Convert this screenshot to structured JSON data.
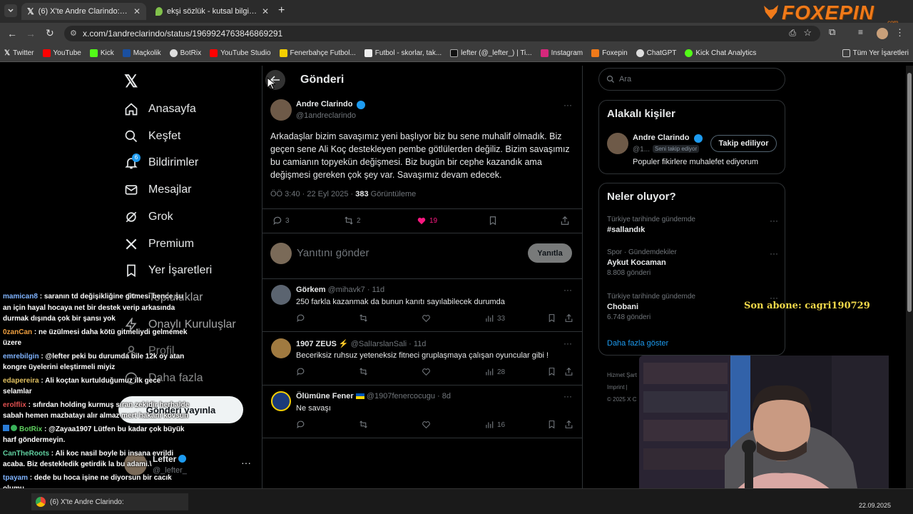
{
  "browser": {
    "tabs": [
      {
        "title": "(6) X'te Andre Clarindo: \"Arkad...",
        "active": true
      },
      {
        "title": "ekşi sözlük - kutsal bilgi kaynağı",
        "active": false
      }
    ],
    "url": "x.com/1andreclarindo/status/1969924763846869291",
    "bookmarks": [
      "Twitter",
      "YouTube",
      "Kick",
      "Maçkolik",
      "BotRix",
      "YouTube Studio",
      "Fenerbahçe Futbol...",
      "Futbol - skorlar, tak...",
      "lefter (@_lefter_) | Ti...",
      "Instagram",
      "Foxepin",
      "ChatGPT",
      "Kick Chat Analytics"
    ],
    "all_bookmarks": "Tüm Yer İşaretleri"
  },
  "brand": {
    "logo_text": "FOXEPIN",
    "logo_sub": ".com"
  },
  "nav": {
    "items": [
      {
        "label": "Anasayfa",
        "icon": "home-icon"
      },
      {
        "label": "Keşfet",
        "icon": "search-icon"
      },
      {
        "label": "Bildirimler",
        "icon": "bell-icon",
        "badge": "6"
      },
      {
        "label": "Mesajlar",
        "icon": "mail-icon"
      },
      {
        "label": "Grok",
        "icon": "grok-icon"
      },
      {
        "label": "Premium",
        "icon": "x-icon"
      },
      {
        "label": "Yer İşaretleri",
        "icon": "bookmark-icon"
      },
      {
        "label": "Topluluklar",
        "icon": "people-icon"
      },
      {
        "label": "Onaylı Kuruluşlar",
        "icon": "lightning-icon"
      },
      {
        "label": "Profil",
        "icon": "person-icon"
      },
      {
        "label": "Daha fazla",
        "icon": "more-icon"
      }
    ],
    "post_button": "Gönderi yayınla",
    "account_name": "Lefter",
    "account_handle": "@_lefter_"
  },
  "header": {
    "title": "Gönderi"
  },
  "tweet": {
    "author": "Andre Clarindo",
    "handle": "@1andreclarindo",
    "text": "Arkadaşlar bizim savaşımız yeni başlıyor biz bu sene muhalif olmadık. Biz geçen sene Ali Koç destekleyen pembe götlülerden değiliz. Bizim savaşımız bu camianın topyekün değişmesi. Biz bugün bir cephe kazandık ama değişmesi gereken çok şey var. Savaşımız devam edecek.",
    "time": "ÖÖ 3:40 · 22 Eyl 2025 ·",
    "views": "383",
    "views_label": "Görüntüleme",
    "replies": "3",
    "reposts": "2",
    "likes": "19"
  },
  "composer": {
    "placeholder": "Yanıtını gönder",
    "button": "Yanıtla"
  },
  "replies": [
    {
      "name": "Görkem",
      "handle": "@mihavk7 · 11d",
      "text": "250 farkla kazanmak da bunun kanıtı sayılabilecek durumda",
      "views": "33"
    },
    {
      "name": "1907 ZEUS ⚡",
      "handle": "@SalIarslanSali · 11d",
      "text": "Beceriksiz ruhsuz yeteneksiz fitneci gruplaşmaya çalışan oyuncular gibi !",
      "views": "28"
    },
    {
      "name": "Ölümüne Fener",
      "handle": "@1907fenercocugu · 8d",
      "text": "Ne savaşı",
      "views": "16"
    }
  ],
  "search": {
    "placeholder": "Ara"
  },
  "related": {
    "title": "Alakalı kişiler",
    "name": "Andre Clarindo",
    "handle": "@1...",
    "follows_you": "Seni takip ediyor",
    "follow_button": "Takip ediliyor",
    "bio": "Populer fikirlere muhalefet ediyorum"
  },
  "trends": {
    "title": "Neler oluyor?",
    "items": [
      {
        "context": "Türkiye tarihinde gündemde",
        "name": "#sallandık",
        "count": ""
      },
      {
        "context": "Spor · Gündemdekiler",
        "name": "Aykut Kocaman",
        "count": "8.808 gönderi"
      },
      {
        "context": "Türkiye tarihinde gündemde",
        "name": "Chobani",
        "count": "6.748 gönderi"
      }
    ],
    "show_more": "Daha fazla göster"
  },
  "footer": {
    "line1": "Hizmet Şart",
    "line2": "Imprint |",
    "line3": "© 2025 X C"
  },
  "overlay": {
    "last_sub": "Son abone: cagri190729"
  },
  "chat": [
    {
      "user": "mamican8",
      "color": "#7fb3ff",
      "msg": "saranın td değişikliğine gitmesi bence şu an için hayal hocaya net bir destek verip arkasında durmak dışında çok bir şansı yok"
    },
    {
      "user": "0zanCan",
      "color": "#f0a040",
      "msg": "ne üzülmesi daha kötü gitmeliydi gelmemek üzere"
    },
    {
      "user": "emrebilgin",
      "color": "#7fb3ff",
      "msg": "@lefter peki bu durumda bile 12k oy atan kongre üyelerini eleştirmeli miyiz"
    },
    {
      "user": "edapereira",
      "color": "#e0c060",
      "msg": "Ali koçtan kurtulduğumuz ilk gece selamlar"
    },
    {
      "user": "erolflix",
      "color": "#e05050",
      "msg": "sıfırdan holding kurmuş sıran zekidir herhalde sabah hemen mazbatayı alır almaz mert hakanı kovsun"
    },
    {
      "user": "BotRix",
      "color": "#60d060",
      "msg": "@Zayaa1907 Lütfen bu kadar çok büyük harf göndermeyin."
    },
    {
      "user": "CanTheRoots",
      "color": "#60d0a0",
      "msg": "Ali koc nasil boyle bi insana evrildi acaba. Biz destekledik getirdik la bu adami.\\"
    },
    {
      "user": "tpayam",
      "color": "#7fb3ff",
      "msg": "dede bu hoca işine ne diyorsun bir cacık olumu"
    }
  ],
  "taskbar": {
    "window_title": "(6) X'te Andre Clarindo:",
    "date": "22.09.2025"
  }
}
